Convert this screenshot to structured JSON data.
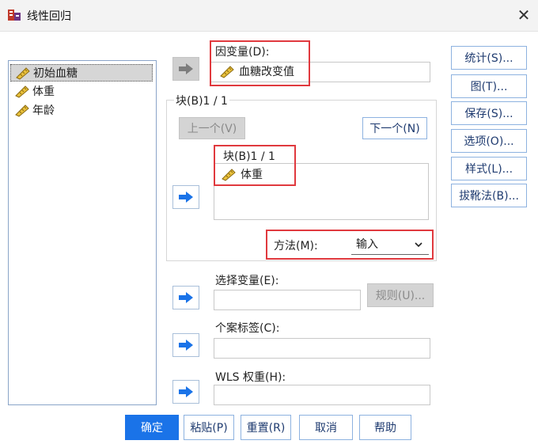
{
  "window": {
    "title": "线性回归",
    "close_glyph": "✕"
  },
  "variables": [
    {
      "name": "初始血糖",
      "selected": true
    },
    {
      "name": "体重",
      "selected": false
    },
    {
      "name": "年龄",
      "selected": false
    }
  ],
  "dependent": {
    "label": "因变量(D):",
    "value": "血糖改变值"
  },
  "block": {
    "label": "块(B)1 / 1",
    "prev_label": "上一个(V)",
    "next_label": "下一个(N)",
    "inner_label": "块(B)1 / 1",
    "independents": [
      "体重"
    ]
  },
  "method": {
    "label": "方法(M):",
    "value": "输入"
  },
  "selection_variable": {
    "label": "选择变量(E):",
    "rule_label": "规则(U)..."
  },
  "case_labels": {
    "label": "个案标签(C):"
  },
  "wls": {
    "label": "WLS 权重(H):"
  },
  "side_buttons": [
    "统计(S)...",
    "图(T)...",
    "保存(S)...",
    "选项(O)...",
    "样式(L)...",
    "拔靴法(B)..."
  ],
  "bottom_buttons": {
    "ok": "确定",
    "paste": "粘贴(P)",
    "reset": "重置(R)",
    "cancel": "取消",
    "help": "帮助"
  },
  "colors": {
    "accent": "#1a73e8",
    "highlight_box": "#e0393e",
    "arrow": "#1a73e8"
  }
}
